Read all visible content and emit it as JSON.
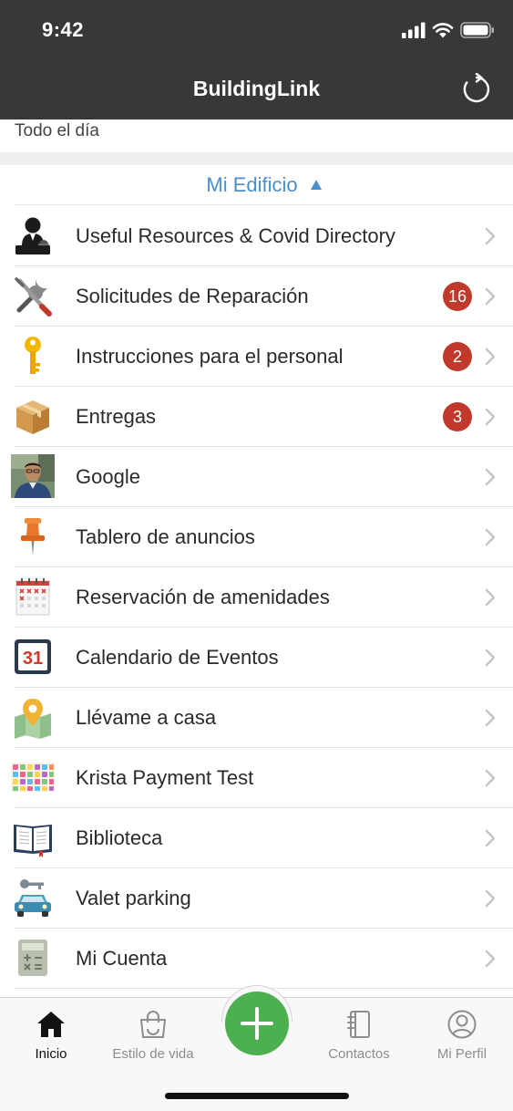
{
  "status_bar": {
    "time": "9:42"
  },
  "header": {
    "title": "BuildingLink"
  },
  "subheader": {
    "text": "Todo el día"
  },
  "section": {
    "title": "Mi Edificio"
  },
  "menu": [
    {
      "label": "Useful Resources & Covid Directory",
      "icon": "concierge-icon",
      "badge": null
    },
    {
      "label": "Solicitudes de Reparación",
      "icon": "tools-icon",
      "badge": "16"
    },
    {
      "label": "Instrucciones para el personal",
      "icon": "key-icon",
      "badge": "2"
    },
    {
      "label": "Entregas",
      "icon": "package-icon",
      "badge": "3"
    },
    {
      "label": "Google",
      "icon": "profile-photo-icon",
      "badge": null
    },
    {
      "label": "Tablero de anuncios",
      "icon": "pushpin-icon",
      "badge": null
    },
    {
      "label": "Reservación de amenidades",
      "icon": "reservation-calendar-icon",
      "badge": null
    },
    {
      "label": "Calendario de Eventos",
      "icon": "calendar-31-icon",
      "badge": null
    },
    {
      "label": "Llévame a casa",
      "icon": "map-pin-icon",
      "badge": null
    },
    {
      "label": "Krista Payment Test",
      "icon": "pattern-icon",
      "badge": null
    },
    {
      "label": "Biblioteca",
      "icon": "book-icon",
      "badge": null
    },
    {
      "label": "Valet parking",
      "icon": "car-key-icon",
      "badge": null
    },
    {
      "label": "Mi Cuenta",
      "icon": "calculator-icon",
      "badge": null
    }
  ],
  "calendar_icon_day": "31",
  "tabbar": {
    "tabs": [
      {
        "label": "Inicio",
        "icon": "home-icon",
        "active": true
      },
      {
        "label": "Estilo de vida",
        "icon": "shopping-bag-icon",
        "active": false
      },
      {
        "label": "Contactos",
        "icon": "contacts-book-icon",
        "active": false
      },
      {
        "label": "Mi Perfil",
        "icon": "profile-icon",
        "active": false
      }
    ],
    "fab_icon": "plus-icon"
  },
  "colors": {
    "header_bg": "#383838",
    "accent": "#4a8fcb",
    "badge": "#c0392b",
    "fab": "#4caf50"
  }
}
